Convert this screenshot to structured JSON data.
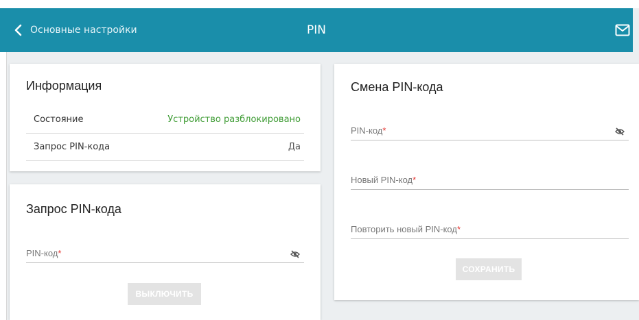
{
  "header": {
    "back_label": "Основные настройки",
    "title": "PIN",
    "bg_color": "#1a8eaa",
    "icons": {
      "back": "chevron-left-icon",
      "mail": "mail-icon"
    }
  },
  "info": {
    "title": "Информация",
    "rows": [
      {
        "label": "Состояние",
        "value": "Устройство разблокировано",
        "value_color": "#3f9c35"
      },
      {
        "label": "Запрос PIN-кода",
        "value": "Да"
      }
    ]
  },
  "pin_request": {
    "title": "Запрос PIN-кода",
    "pin_field": {
      "label": "PIN-код",
      "required_mark": "*",
      "value": ""
    },
    "disable_button": "ВЫКЛЮЧИТЬ"
  },
  "pin_change": {
    "title": "Смена PIN-кода",
    "fields": [
      {
        "label": "PIN-код",
        "required_mark": "*",
        "value": "",
        "has_visibility_toggle": true
      },
      {
        "label": "Новый PIN-код",
        "required_mark": "*",
        "value": ""
      },
      {
        "label": "Повторить новый PIN-код",
        "required_mark": "*",
        "value": ""
      }
    ],
    "save_button": "СОХРАНИТЬ"
  }
}
